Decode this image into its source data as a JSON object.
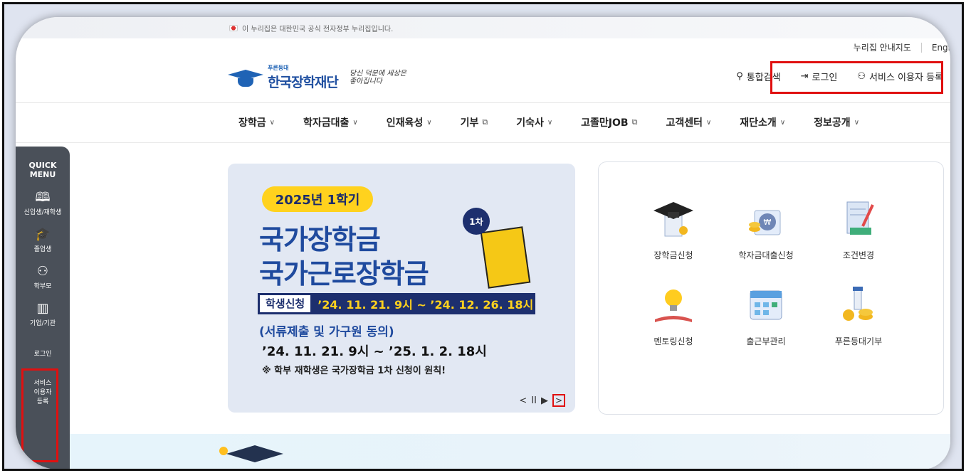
{
  "gov_notice": "이 누리집은 대한민국 공식 전자정부 누리집입니다.",
  "util_links": [
    "누리집 안내지도",
    "Engl"
  ],
  "logo": {
    "sub": "푸른등대",
    "name": "한국장학재단",
    "slogan": "당신 덕분에 세상은 좋아집니다"
  },
  "header_actions": {
    "search": "통합검색",
    "login": "로그인",
    "register": "서비스 이용자 등록"
  },
  "nav": [
    {
      "label": "장학금",
      "suffix": "∨"
    },
    {
      "label": "학자금대출",
      "suffix": "∨"
    },
    {
      "label": "인재육성",
      "suffix": "∨"
    },
    {
      "label": "기부",
      "suffix": "⧉"
    },
    {
      "label": "기숙사",
      "suffix": "∨"
    },
    {
      "label": "고졸만JOB",
      "suffix": "⧉"
    },
    {
      "label": "고객센터",
      "suffix": "∨"
    },
    {
      "label": "재단소개",
      "suffix": "∨"
    },
    {
      "label": "정보공개",
      "suffix": "∨"
    }
  ],
  "quick_menu": {
    "title_1": "QUICK",
    "title_2": "MENU",
    "items": [
      "신입생/재학생",
      "졸업생",
      "학부모",
      "기업/기관"
    ],
    "login": "로그인",
    "register_1": "서비스",
    "register_2": "이용자",
    "register_3": "등록"
  },
  "banner": {
    "semester": "2025년 1학기",
    "title_1": "국가장학금",
    "title_2": "국가근로장학금",
    "apply_label": "학생신청",
    "apply_dates": "’24. 11. 21. 9시 ~ ’24. 12. 26. 18시",
    "docs_label": "(서류제출 및 가구원 동의)",
    "docs_dates": "’24. 11. 21. 9시 ~ ’25. 1. 2. 18시",
    "note": "※ 학부 재학생은 국가장학금 1차 신청이 원칙!",
    "badge": "1차",
    "controls": {
      "prev": "<",
      "pause": "II",
      "play": "▶",
      "next": ">"
    }
  },
  "services": [
    {
      "label": "장학금신청",
      "icon": "graduation-cap-icon"
    },
    {
      "label": "학자금대출신청",
      "icon": "money-bag-icon"
    },
    {
      "label": "조건변경",
      "icon": "document-pen-icon"
    },
    {
      "label": "멘토링신청",
      "icon": "lightbulb-book-icon"
    },
    {
      "label": "출근부관리",
      "icon": "calendar-icon"
    },
    {
      "label": "푸른등대기부",
      "icon": "lighthouse-coins-icon"
    }
  ],
  "colors": {
    "brand_blue": "#1f4a9e",
    "highlight_red": "#e01010",
    "banner_yellow": "#ffd21e",
    "quick_bg": "#4a5059"
  }
}
